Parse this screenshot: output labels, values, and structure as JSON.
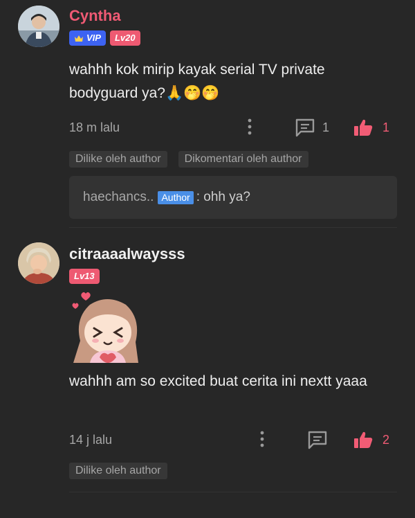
{
  "comments": [
    {
      "username": "Cyntha",
      "badges": {
        "vip": "VIP",
        "level": "Lv20"
      },
      "text": "wahhh kok mirip kayak serial TV private bodyguard ya?🙏🤭🤭",
      "time": "18 m lalu",
      "reply_count": "1",
      "like_count": "1",
      "chips": [
        "Dilike oleh author",
        "Dikomentari oleh author"
      ],
      "reply": {
        "name": "haechancs..",
        "tag": "Author",
        "text": ": ohh ya?"
      }
    },
    {
      "username": "citraaaalwaysss",
      "badges": {
        "level": "Lv13"
      },
      "text": "wahhh am so excited buat cerita ini nextt yaaa",
      "time": "14 j lalu",
      "like_count": "2",
      "chips": [
        "Dilike oleh author"
      ]
    }
  ],
  "colors": {
    "accent": "#f05a74",
    "vip": "#3d63f2",
    "author_tag": "#4a8fe7",
    "background": "#272727"
  },
  "icons": [
    "more-vertical-icon",
    "comment-icon",
    "thumbs-up-icon",
    "crown-icon",
    "heart-icon"
  ]
}
